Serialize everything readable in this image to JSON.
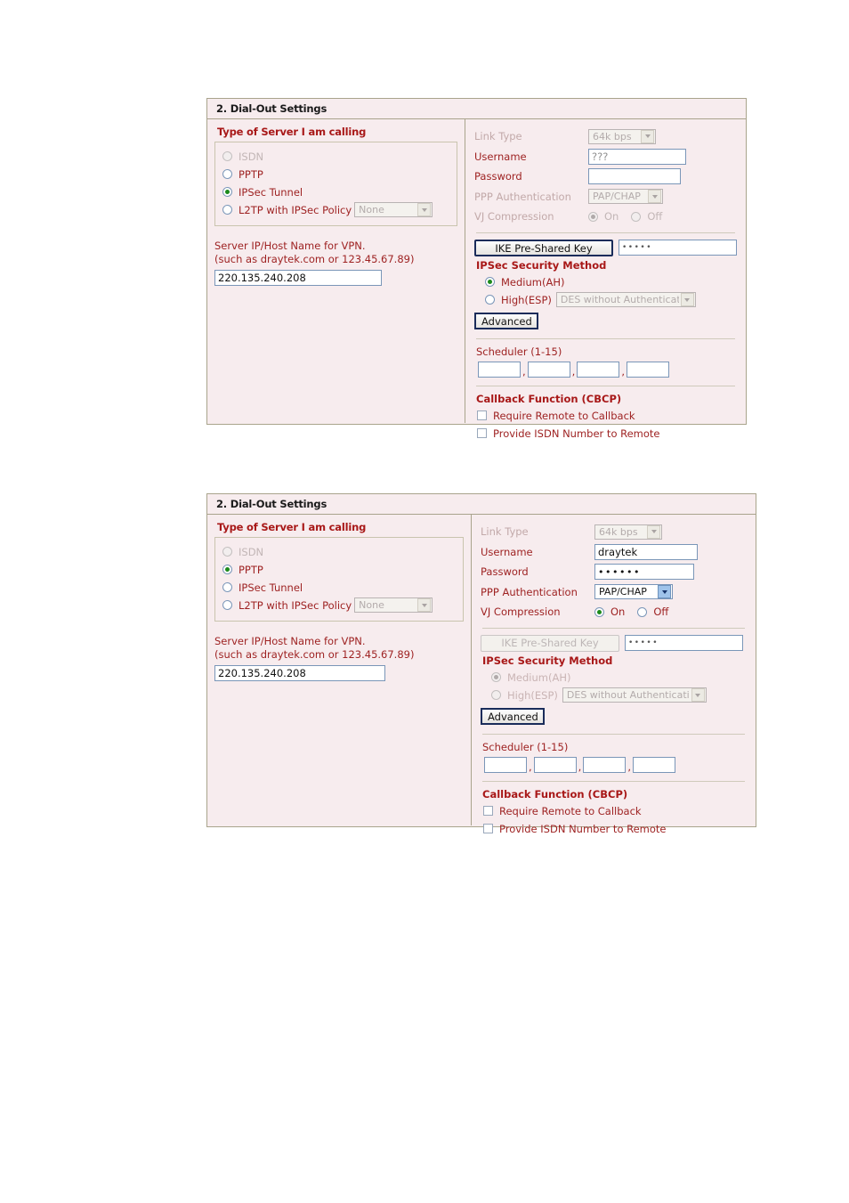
{
  "panels": [
    {
      "title": "2. Dial-Out Settings",
      "left": {
        "heading": "Type of Server I am calling",
        "options": [
          {
            "label": "ISDN",
            "selected": false,
            "disabled": true
          },
          {
            "label": "PPTP",
            "selected": false,
            "disabled": false
          },
          {
            "label": "IPSec Tunnel",
            "selected": true,
            "disabled": false
          },
          {
            "label": "L2TP with IPSec Policy",
            "selected": false,
            "disabled": false
          }
        ],
        "l2tp_policy_value": "None",
        "server_hint_line1": "Server IP/Host Name for VPN.",
        "server_hint_line2": "(such as draytek.com or 123.45.67.89)",
        "server_ip_value": "220.135.240.208"
      },
      "right": {
        "link_type_label": "Link Type",
        "link_type_value": "64k bps",
        "link_type_enabled": false,
        "username_label": "Username",
        "username_value": "???",
        "username_enabled": false,
        "password_label": "Password",
        "password_value": "",
        "password_enabled": false,
        "ppp_auth_label": "PPP Authentication",
        "ppp_auth_value": "PAP/CHAP",
        "ppp_auth_enabled": false,
        "vj_label": "VJ Compression",
        "vj_on_label": "On",
        "vj_off_label": "Off",
        "vj_value": "On",
        "vj_enabled": false,
        "ike_button_label": "IKE Pre-Shared Key",
        "ike_button_enabled": true,
        "ike_key_value": "•••••",
        "ipsec_heading": "IPSec Security Method",
        "ipsec_options": [
          {
            "label": "Medium(AH)",
            "selected": true
          },
          {
            "label": "High(ESP)",
            "selected": false
          }
        ],
        "esp_value": "DES without Authentication",
        "advanced_label": "Advanced",
        "advanced_enabled": true,
        "scheduler_label": "Scheduler (1-15)",
        "scheduler_values": [
          "",
          "",
          "",
          ""
        ],
        "callback_heading": "Callback Function (CBCP)",
        "callback_options": [
          {
            "label": "Require Remote to Callback",
            "checked": false
          },
          {
            "label": "Provide ISDN Number to Remote",
            "checked": false
          }
        ]
      }
    },
    {
      "title": "2. Dial-Out Settings",
      "left": {
        "heading": "Type of Server I am calling",
        "options": [
          {
            "label": "ISDN",
            "selected": false,
            "disabled": true
          },
          {
            "label": "PPTP",
            "selected": true,
            "disabled": false
          },
          {
            "label": "IPSec Tunnel",
            "selected": false,
            "disabled": false
          },
          {
            "label": "L2TP with IPSec Policy",
            "selected": false,
            "disabled": false
          }
        ],
        "l2tp_policy_value": "None",
        "server_hint_line1": "Server IP/Host Name for VPN.",
        "server_hint_line2": "(such as draytek.com or 123.45.67.89)",
        "server_ip_value": "220.135.240.208"
      },
      "right": {
        "link_type_label": "Link Type",
        "link_type_value": "64k bps",
        "link_type_enabled": false,
        "username_label": "Username",
        "username_value": "draytek",
        "username_enabled": true,
        "password_label": "Password",
        "password_value": "••••••",
        "password_enabled": true,
        "ppp_auth_label": "PPP Authentication",
        "ppp_auth_value": "PAP/CHAP",
        "ppp_auth_enabled": true,
        "vj_label": "VJ Compression",
        "vj_on_label": "On",
        "vj_off_label": "Off",
        "vj_value": "On",
        "vj_enabled": true,
        "ike_button_label": "IKE Pre-Shared Key",
        "ike_button_enabled": false,
        "ike_key_value": "•••••",
        "ipsec_heading": "IPSec Security Method",
        "ipsec_options": [
          {
            "label": "Medium(AH)",
            "selected": true
          },
          {
            "label": "High(ESP)",
            "selected": false
          }
        ],
        "esp_value": "DES without Authentication",
        "advanced_label": "Advanced",
        "advanced_enabled": true,
        "scheduler_label": "Scheduler (1-15)",
        "scheduler_values": [
          "",
          "",
          "",
          ""
        ],
        "callback_heading": "Callback Function (CBCP)",
        "callback_options": [
          {
            "label": "Require Remote to Callback",
            "checked": false
          },
          {
            "label": "Provide ISDN Number to Remote",
            "checked": false
          }
        ]
      }
    }
  ],
  "colors": {
    "panel_bg": "#f7ecee",
    "panel_border": "#a9a48c",
    "label_red": "#9e2222",
    "heading_red": "#a81818",
    "radio_green": "#1c8a1c",
    "input_border": "#7a96b8"
  }
}
